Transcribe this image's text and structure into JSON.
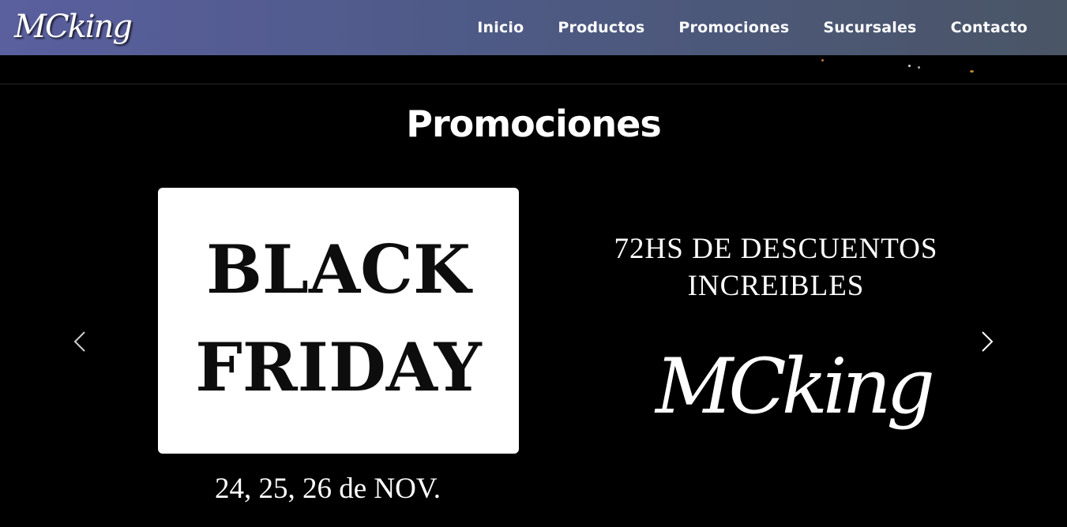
{
  "header": {
    "logo_text": "MCking",
    "nav": [
      "Inicio",
      "Productos",
      "Promociones",
      "Sucursales",
      "Contacto"
    ]
  },
  "section": {
    "title": "Promociones"
  },
  "slides": {
    "left": {
      "line1": "BLACK",
      "line2": "FRIDAY",
      "dates": "24, 25, 26 de NOV."
    },
    "right": {
      "line1": "72HS DE DESCUENTOS",
      "line2": "INCREIBLES",
      "logo_text": "MCking"
    }
  },
  "icons": {
    "prev": "chevron-left-icon",
    "next": "chevron-right-icon"
  },
  "colors": {
    "header_start": "#5a5f9e",
    "header_end": "#4a5566",
    "background": "#000000"
  }
}
